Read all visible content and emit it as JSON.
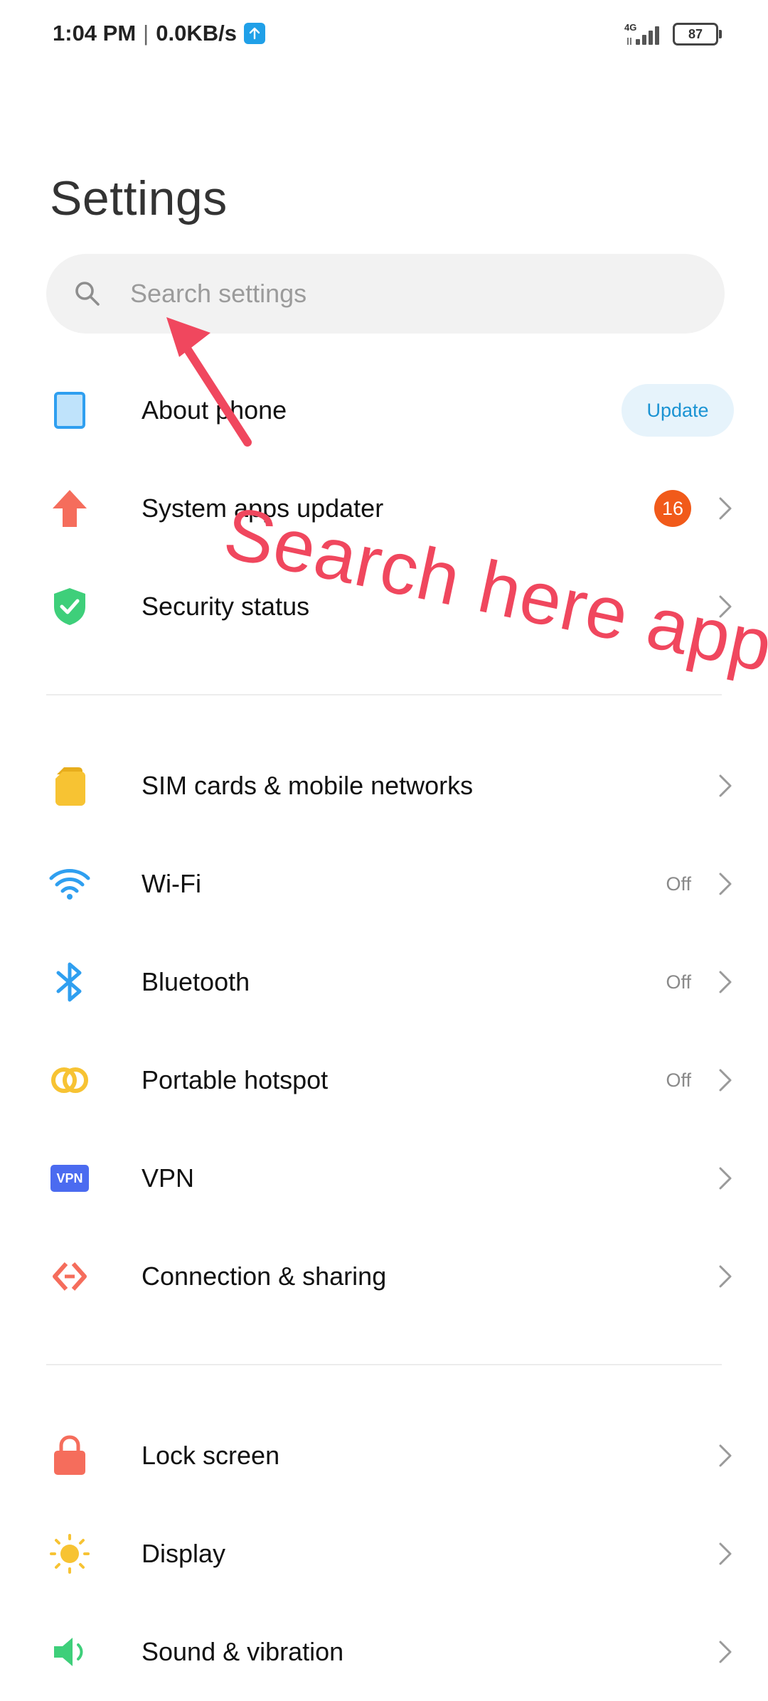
{
  "status_bar": {
    "time": "1:04 PM",
    "separator": "|",
    "speed": "0.0KB/s",
    "network_type": "4G",
    "battery": "87"
  },
  "header": {
    "title": "Settings"
  },
  "search": {
    "placeholder": "Search settings"
  },
  "rows": {
    "about_phone": {
      "label": "About phone",
      "button": "Update",
      "icon": "phone-icon"
    },
    "system_apps_updater": {
      "label": "System apps updater",
      "badge": "16",
      "icon": "up-arrow-icon"
    },
    "security_status": {
      "label": "Security status",
      "icon": "shield-check-icon"
    },
    "sim_cards": {
      "label": "SIM cards & mobile networks",
      "icon": "sim-card-icon"
    },
    "wifi": {
      "label": "Wi-Fi",
      "value": "Off",
      "icon": "wifi-icon"
    },
    "bluetooth": {
      "label": "Bluetooth",
      "value": "Off",
      "icon": "bluetooth-icon"
    },
    "hotspot": {
      "label": "Portable hotspot",
      "value": "Off",
      "icon": "hotspot-icon"
    },
    "vpn": {
      "label": "VPN",
      "icon_text": "VPN",
      "icon": "vpn-icon"
    },
    "connection_sharing": {
      "label": "Connection & sharing",
      "icon": "connection-sharing-icon"
    },
    "lock_screen": {
      "label": "Lock screen",
      "icon": "lock-icon"
    },
    "display": {
      "label": "Display",
      "icon": "sun-icon"
    },
    "sound": {
      "label": "Sound & vibration",
      "icon": "speaker-icon"
    }
  },
  "annotation": {
    "text": "Search here apps",
    "color": "#f0475e"
  },
  "colors": {
    "accent_blue": "#1a93d3",
    "badge_orange": "#f15a1a",
    "security_green": "#3ecf7a",
    "sim_yellow": "#f7c333",
    "wifi_blue": "#2f9ff0",
    "vpn_blue": "#4b6bf0",
    "lock_coral": "#f56d5c"
  }
}
